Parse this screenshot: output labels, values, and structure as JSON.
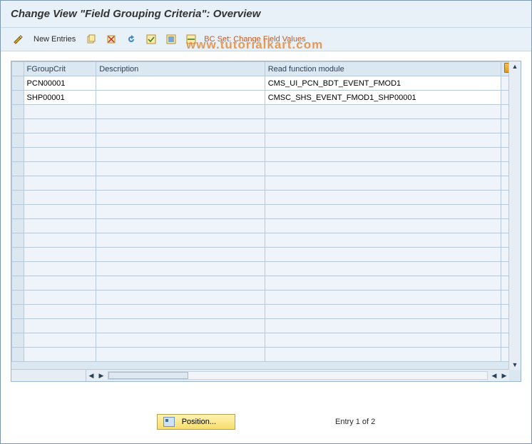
{
  "title": "Change View \"Field Grouping Criteria\": Overview",
  "toolbar": {
    "new_entries": "New Entries",
    "bc_set": "BC Set: Change Field Values"
  },
  "watermark": "www.tutorialkart.com",
  "columns": {
    "fgroupcrit": "FGroupCrit",
    "description": "Description",
    "readfn": "Read function module"
  },
  "rows": [
    {
      "fgroupcrit": "PCN00001",
      "description": "",
      "readfn": "CMS_UI_PCN_BDT_EVENT_FMOD1"
    },
    {
      "fgroupcrit": "SHP00001",
      "description": "",
      "readfn": "CMSC_SHS_EVENT_FMOD1_SHP00001"
    }
  ],
  "footer": {
    "position_label": "Position...",
    "entry_text": "Entry 1 of 2"
  }
}
